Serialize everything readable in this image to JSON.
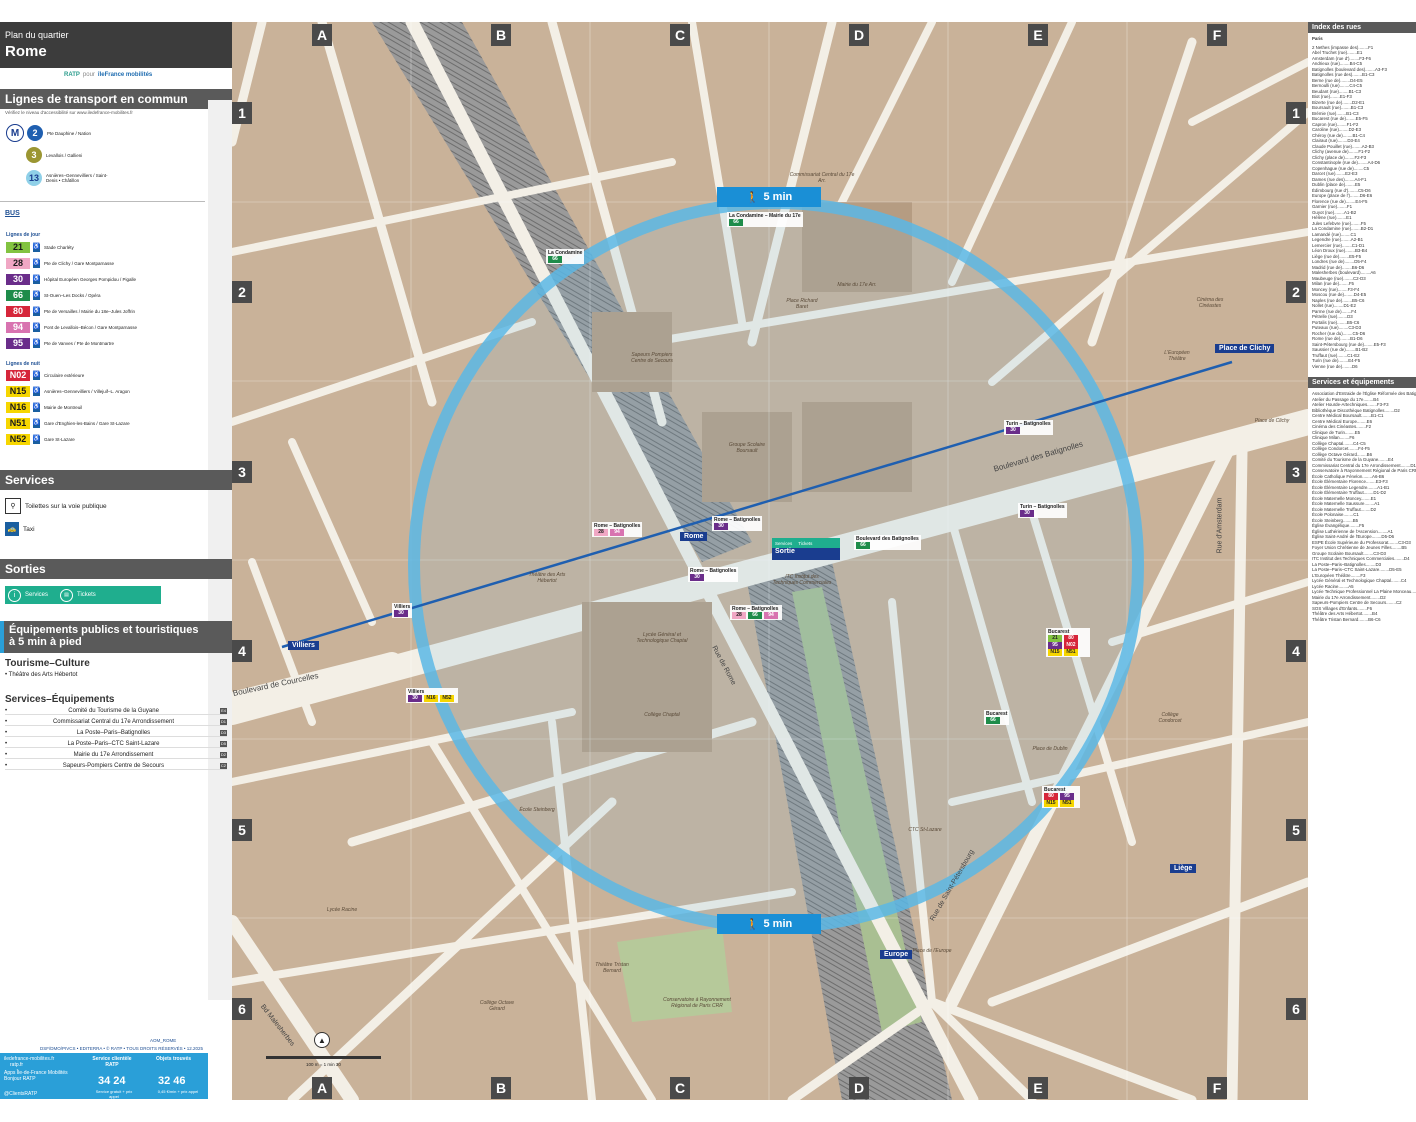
{
  "header": {
    "kicker": "Plan du quartier",
    "title": "Rome",
    "brand_ratp": "RATP",
    "brand_pour": "pour",
    "brand_idfm": "îleFrance mobilités"
  },
  "transport": {
    "title": "Lignes de transport en commun",
    "accessibility_note": "Vérifiez le niveau d'accessibilité sur www.iledefrance-mobilites.fr",
    "metro_lines": [
      {
        "num": "2",
        "color": "#1f5fb0",
        "text_color": "#ffffff",
        "dest": "Pte Dauphine / Nation"
      },
      {
        "num": "3",
        "color": "#9b9632",
        "text_color": "#ffffff",
        "dest": "Levallois / Gallieni"
      },
      {
        "num": "13",
        "color": "#8fd0e8",
        "text_color": "#1a3d8f",
        "dest": "Asnières–Gennevilliers / Saint-Denis • Châtillon"
      }
    ],
    "metro_prefix": "M",
    "bus_label": "BUS",
    "bus_day_label": "Lignes de jour",
    "bus_lines": [
      {
        "num": "21",
        "color": "#82c341",
        "text_color": "#1a1a1a",
        "dest": "Stade Charléty"
      },
      {
        "num": "28",
        "color": "#f0a7c4",
        "text_color": "#1a1a1a",
        "dest": "Pte de Clichy / Gare Montparnasse"
      },
      {
        "num": "30",
        "color": "#6a2d8a",
        "text_color": "#ffffff",
        "dest": "Hôpital Européen Georges Pompidou / Pigalle"
      },
      {
        "num": "66",
        "color": "#1e8c4a",
        "text_color": "#ffffff",
        "dest": "St-Ouen–Les Docks / Opéra"
      },
      {
        "num": "80",
        "color": "#d6263a",
        "text_color": "#ffffff",
        "dest": "Pte de Versailles / Mairie du 18e–Jules Joffrin"
      },
      {
        "num": "94",
        "color": "#d873b0",
        "text_color": "#ffffff",
        "dest": "Pont de Levallois–Bécon / Gare Montparnasse"
      },
      {
        "num": "95",
        "color": "#6a2d8a",
        "text_color": "#ffffff",
        "dest": "Pte de Vanves / Pte de Montmartre"
      }
    ],
    "bus_night_label": "Lignes de nuit",
    "night_lines": [
      {
        "num": "N02",
        "color": "#d6263a",
        "text_color": "#ffffff",
        "dest": "Circulaire extérieure"
      },
      {
        "num": "N15",
        "color": "#f6d600",
        "text_color": "#1a1a1a",
        "dest": "Asnières–Gennevilliers / Villejuif–L. Aragon"
      },
      {
        "num": "N16",
        "color": "#f6d600",
        "text_color": "#1a1a1a",
        "dest": "Mairie de Montreuil"
      },
      {
        "num": "N51",
        "color": "#f6d600",
        "text_color": "#1a1a1a",
        "dest": "Gare d'Enghien-les-Bains / Gare St-Lazare"
      },
      {
        "num": "N52",
        "color": "#f6d600",
        "text_color": "#1a1a1a",
        "dest": "Gare St-Lazare"
      }
    ]
  },
  "services": {
    "title": "Services",
    "items": [
      {
        "label": "Toilettes sur la voie publique",
        "refs": "B4 F3"
      },
      {
        "label": "Taxi",
        "refs": "B4 F3"
      }
    ]
  },
  "sorties": {
    "title": "Sorties",
    "services_label": "Services",
    "tickets_label": "Tickets"
  },
  "equipements": {
    "title_line1": "Équipements publics et touristiques",
    "title_line2": "à 5 min à pied",
    "tourisme_title": "Tourisme–Culture",
    "tourisme_items": [
      {
        "label": "Théâtre des Arts Hébertot",
        "ref": ""
      }
    ],
    "services_title": "Services–Équipements",
    "services_items": [
      {
        "label": "Comité du Tourisme de la Guyane",
        "ref": "E4"
      },
      {
        "label": "Commissariat Central du 17e Arrondissement",
        "ref": "D1"
      },
      {
        "label": "La Poste–Paris–Batignolles",
        "ref": "D3"
      },
      {
        "label": "La Poste–Paris–CTC Saint-Lazare",
        "ref": "D5"
      },
      {
        "label": "Mairie du 17e Arrondissement",
        "ref": "D2"
      },
      {
        "label": "Sapeurs-Pompiers Centre de Secours",
        "ref": "C2"
      }
    ]
  },
  "footer": {
    "code": "AOM_ROME",
    "copyright": "DSF/DMO/PIVCS • EDITERRA • © RATP • TOUS DROITS RÉSERVÉS • 12.2025",
    "web": "iledefrance-mobilites.fr",
    "web2": "ratp.fr",
    "apps": "Apps Île-de-France Mobilités Bonjour RATP",
    "social": "@ClientsRATP",
    "client_title": "Service clientèle RATP",
    "client_phone": "34 24",
    "client_note": "Service gratuit + prix appel",
    "lost_title": "Objets trouvés",
    "lost_phone": "32 46",
    "lost_note": "0,45 €/min + prix appel",
    "scale": "100 m = 1 min 30"
  },
  "map": {
    "cols": [
      "A",
      "B",
      "C",
      "D",
      "E",
      "F"
    ],
    "rows": [
      "1",
      "2",
      "3",
      "4",
      "5",
      "6"
    ],
    "walk_label": "5 min",
    "metro_stations": [
      {
        "name": "Rome",
        "lines": "2"
      },
      {
        "name": "Villiers",
        "lines": "2 3"
      },
      {
        "name": "Place de Clichy",
        "lines": "2 13"
      },
      {
        "name": "Liège",
        "lines": "13"
      },
      {
        "name": "Europe",
        "lines": "3"
      }
    ],
    "exit_label": "Sortie",
    "exit_services": "Services",
    "exit_tickets": "Tickets",
    "streets": [
      "Boulevard des Batignolles",
      "Boulevard de Courcelles",
      "Rue de Rome",
      "Rue de Saint-Pétersbourg",
      "Bd Malesherbes",
      "Rue d'Amsterdam"
    ],
    "places": [
      "Lycée Général et Technologique Chaptal",
      "Collège Chaptal",
      "Théâtre des Arts Hébertot",
      "Groupe Scolaire Boursault",
      "Mairie du 17e Arr.",
      "Commissariat Central du 17e Arr.",
      "Sapeurs Pompiers Centre de Secours",
      "ITC Institut des Techniques Commerciales",
      "École Steinberg",
      "Lycée Racine",
      "Collège Octave Gérard",
      "Conservatoire à Rayonnement Régional de Paris CRR",
      "Théâtre Tristan Bernard",
      "CTC St-Lazare",
      "Collège Condorcet",
      "L'Européen Théâtre",
      "Cinéma des Cinéastes",
      "Place Richard Baret",
      "Place de Dublin",
      "Place de l'Europe",
      "Place de Clichy"
    ],
    "bus_stops": [
      {
        "name": "La Condamine – Mairie du 17e",
        "lines": [
          "66"
        ]
      },
      {
        "name": "La Condamine",
        "lines": [
          "66"
        ]
      },
      {
        "name": "Rome – Batignolles",
        "lines": [
          "28",
          "94"
        ]
      },
      {
        "name": "Rome – Batignolles",
        "lines": [
          "30"
        ]
      },
      {
        "name": "Rome – Batignolles",
        "lines": [
          "30"
        ]
      },
      {
        "name": "Rome – Batignolles",
        "lines": [
          "28",
          "66",
          "94"
        ]
      },
      {
        "name": "Boulevard des Batignolles",
        "lines": [
          "66"
        ]
      },
      {
        "name": "Villiers",
        "lines": [
          "30"
        ]
      },
      {
        "name": "Villiers",
        "lines": [
          "30",
          "N16",
          "N52"
        ]
      },
      {
        "name": "Turin – Batignolles",
        "lines": [
          "30"
        ]
      },
      {
        "name": "Turin – Batignolles",
        "lines": [
          "30"
        ]
      },
      {
        "name": "Bucarest",
        "lines": [
          "21",
          "80",
          "95",
          "N02",
          "N15",
          "N51"
        ]
      },
      {
        "name": "Bucarest",
        "lines": [
          "66"
        ]
      },
      {
        "name": "Bucarest",
        "lines": [
          "80",
          "95",
          "N15",
          "N51"
        ]
      }
    ]
  },
  "index_rues": {
    "title": "Index des rues",
    "city": "Paris",
    "items": [
      "2 Nethes (impasse des)........F1",
      "Abel Truchet (rue)........E1",
      "Amsterdam (rue d')........F3-F6",
      "Andrieux (rue)........B4-C5",
      "Batignolles (boulevard des)........A3-F3",
      "Batignolles (rue des)........B1-C3",
      "Berne (rue de)........D4-E5",
      "Bernoulli (rue)........C4-C5",
      "Beudant (rue)........B1-C3",
      "Biot (rue)........E1-F3",
      "Bizerte (rue de)........D2-E1",
      "Boursault (rue)........B1-C3",
      "Brémie (rue)........B1-C3",
      "Bucarest (rue de)........E5-F5",
      "Capron (rue)........F1-F2",
      "Caroline (rue)........D2-E3",
      "Chéroy (rue de)........B1-C4",
      "Clairaut (rue)........D3-E4",
      "Claude Pouillet (rue)........A2-B3",
      "Clichy (avenue de)........F1-F2",
      "Clichy (place de)........F2-F3",
      "Constantinople (rue de)........A4-D6",
      "Copenhague (rue de)........C5",
      "Darcet (rue)........E2-E3",
      "Dames (rue des)........A4-F1",
      "Dublin (place de)........E5",
      "Édimbourg (rue d')........C5-D6",
      "Europe (place de l')........D6-E6",
      "Florence (rue de)........E4-F5",
      "Garnier (rue)........F1",
      "Guyot (rue)........A1-B2",
      "Hélène (rue)........E1",
      "Jules Lefebvre (rue)........F5",
      "La Condamine (rue)........B2-D1",
      "Lamandé (rue)........C1",
      "Legendre (rue)........A2-B1",
      "Lemercier (rue)........C1-D1",
      "Léon Droux (rue)........B3-B4",
      "Liège (rue de)........E5-F5",
      "Londres (rue de)........D5-F4",
      "Madrid (rue de)........B6-D6",
      "Malesherbes (boulevard)........A6",
      "Maubeuge (rue)........C2-D3",
      "Milan (rue de)........F5",
      "Moncey (rue)........F3-F4",
      "Moscou (rue de)........D4-E5",
      "Naples (rue de)........B5-C6",
      "Nollet (rue)........D1-E2",
      "Parme (rue de)........F4",
      "Pétrelle (rue)........D3",
      "Portalis (rue)........B5-C6",
      "Puteaux (rue)........C3-D3",
      "Rocher (rue du)........C5-D6",
      "Rome (rue de)........B1-D6",
      "Saint-Pétersbourg (rue de)........E5-F3",
      "Saussier (rue de)........B1-B2",
      "Truffaut (rue)........C1-E2",
      "Turin (rue de)........E4-F5",
      "Vienne (rue de)........D6"
    ]
  },
  "services_equip": {
    "title": "Services et équipements",
    "items": [
      "Association d'Entraide de l'Église Réformée des Batignolles........D3",
      "Atelier du Passage du 17e........B4",
      "Atelier Hourde-Artechniques........F3-F3",
      "Bibliothèque Discothèque Batignolles........D2",
      "Centre Médical Boursault........B1-C1",
      "Centre Médical Europe........E6",
      "Cinéma des Cinéastes........F2",
      "Clinique de Turin........E5",
      "Clinique Milan........F6",
      "Collège Chaptal........C4-C5",
      "Collège Condorcet........F4-F5",
      "Collège Octave Gérard........B6",
      "Comité du Tourisme de la Guyane........E4",
      "Commissariat Central du 17e Arrondissement........D1-D2",
      "Conservatoire à Rayonnement Régional de Paris CRR........C6",
      "École Catholique Fénelon........A6-B6",
      "École Élémentaire Florence........E3-F3",
      "École Élémentaire Legendre........A1-B1",
      "École Élémentaire Truffaut........D1-D2",
      "École Maternelle Moncey........E1",
      "École Maternelle Saussure........A1",
      "École Maternelle Truffaut........D2",
      "École Polonaise........C1",
      "École Steinberg........B5",
      "Église Évangélique........F5",
      "Église Luthérienne de l'Ascension........A1",
      "Église Saint-André de l'Europe........D5-D6",
      "ESPE École Supérieure du Professorat........C3-D3",
      "Foyer Union Chrétienne de Jeunes Filles........B5",
      "Groupe Scolaire Boursault........C3-D3",
      "ITC Institut des Techniques Commerciales........D4",
      "La Poste–Paris–Batignolles........D3",
      "La Poste–Paris–CTC Saint-Lazare........D5-E5",
      "L'Européen Théâtre........F3",
      "Lycée Général et Technologique Chaptal........C4",
      "Lycée Racine........A5",
      "Lycée Technique Professionnel La Plaine Monceau........A4",
      "Mairie du 17e Arrondissement........D2",
      "Sapeurs-Pompiers Centre de Secours........C2",
      "SOS Villages d'Enfants........F6",
      "Théâtre des Arts Hébertot........B4",
      "Théâtre Tristan Bernard........B6-C6"
    ]
  }
}
